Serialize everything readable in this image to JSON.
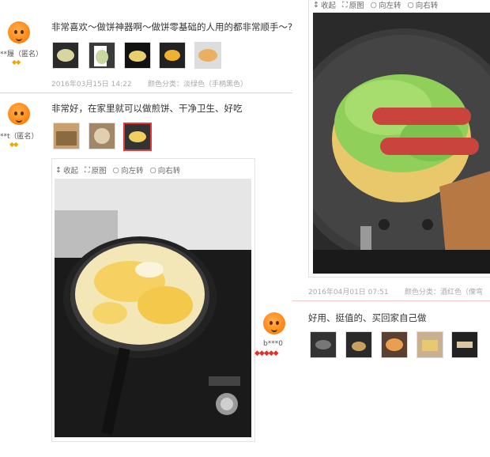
{
  "reviews": [
    {
      "user": "**履（匿名）",
      "text": "非常喜欢～做饼神器啊～做饼零基础的人用的都非常顺手～?",
      "date": "2016年03月15日 14:22",
      "color_label": "颜色分类：淡绿色（手柄黑色）",
      "medals": "◆◆"
    },
    {
      "user": "**t（匿名）",
      "text": "非常好，在家里就可以做煎饼、干净卫生、好吃",
      "medals": "◆◆",
      "toolbar": {
        "collapse": "收起",
        "original": "原图",
        "rotate_left": "向左转",
        "rotate_right": "向右转"
      }
    },
    {
      "user": "b***0",
      "text": "好用、挺值的、买回家自己做",
      "medals": "◆◆◆◆◆"
    }
  ],
  "right_panel": {
    "toolbar": {
      "collapse": "收起",
      "original": "原图",
      "rotate_left": "向左转",
      "rotate_right": "向右转"
    },
    "date": "2016年04月01日 07:51",
    "color_label": "颜色分类：酒红色（傈弯"
  },
  "colors": {
    "accent": "#e4393c",
    "avatar": "#ff8a1a",
    "meta": "#aaaaaa"
  }
}
